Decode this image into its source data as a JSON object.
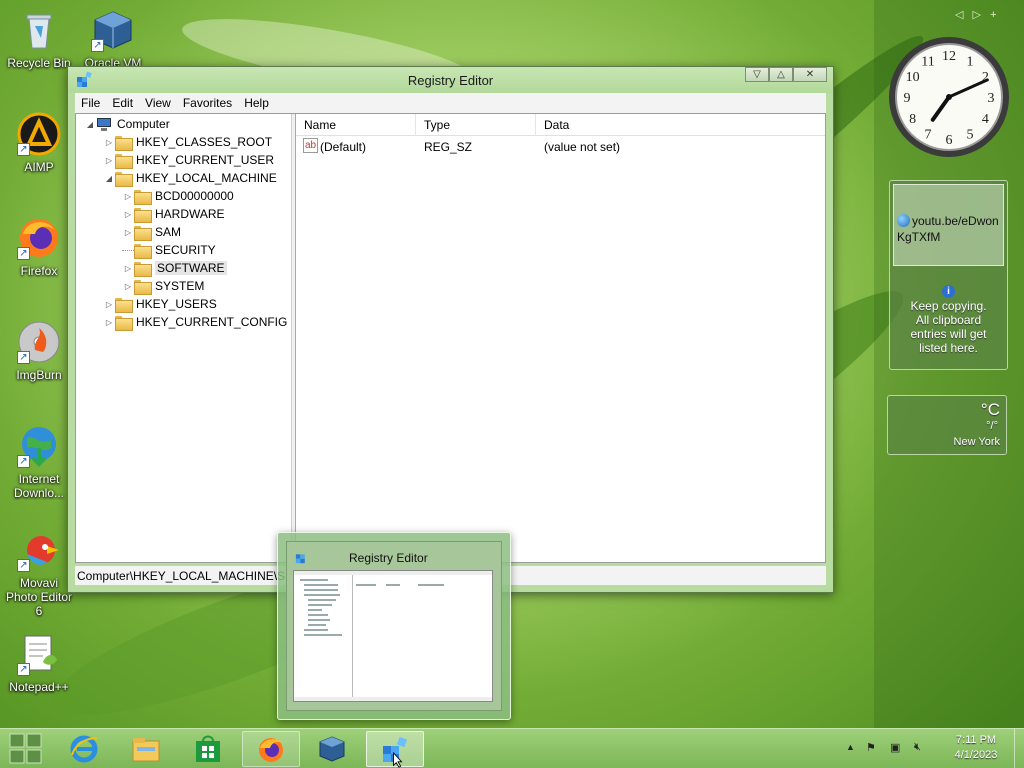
{
  "desktop": {
    "icons": [
      {
        "label": "Recycle Bin"
      },
      {
        "label": "Oracle VM"
      },
      {
        "label": "AIMP"
      },
      {
        "label": "Firefox"
      },
      {
        "label": "ImgBurn"
      },
      {
        "label": "Internet Downlo..."
      },
      {
        "label": "Movavi Photo Editor 6"
      },
      {
        "label": "Notepad++"
      }
    ]
  },
  "window": {
    "title": "Registry Editor",
    "menu": [
      "File",
      "Edit",
      "View",
      "Favorites",
      "Help"
    ],
    "tree": [
      {
        "label": "Computer",
        "expander": "◢",
        "icon": "computer-icon"
      },
      {
        "label": "HKEY_CLASSES_ROOT",
        "expander": "▷"
      },
      {
        "label": "HKEY_CURRENT_USER",
        "expander": "▷"
      },
      {
        "label": "HKEY_LOCAL_MACHINE",
        "expander": "◢"
      },
      {
        "label": "BCD00000000",
        "expander": "▷"
      },
      {
        "label": "HARDWARE",
        "expander": "▷"
      },
      {
        "label": "SAM",
        "expander": "▷"
      },
      {
        "label": "SECURITY",
        "expander": ""
      },
      {
        "label": "SOFTWARE",
        "expander": "▷",
        "selected": true
      },
      {
        "label": "SYSTEM",
        "expander": "▷"
      },
      {
        "label": "HKEY_USERS",
        "expander": "▷"
      },
      {
        "label": "HKEY_CURRENT_CONFIG",
        "expander": "▷"
      }
    ],
    "columns": [
      "Name",
      "Type",
      "Data"
    ],
    "rows": [
      {
        "name": "(Default)",
        "type": "REG_SZ",
        "data": "(value not set)",
        "icon": "string-value-icon"
      }
    ],
    "status": "Computer\\HKEY_LOCAL_MACHINE\\S"
  },
  "thumbnail": {
    "title": "Registry Editor"
  },
  "gadgets": {
    "clipboard": {
      "entry": "youtu.be/eDwonKgTXfM",
      "info": "Keep copying. All clipboard entries will get listed here."
    },
    "weather": {
      "temp": "°C",
      "range": "°/°",
      "city": "New York"
    },
    "clock": {
      "hour": 7,
      "minute": 11
    }
  },
  "taskbar": {
    "time": "7:11 PM",
    "date": "4/1/2023"
  },
  "colors": {
    "accent": "#7cb657",
    "folder": "#e9b94b"
  }
}
